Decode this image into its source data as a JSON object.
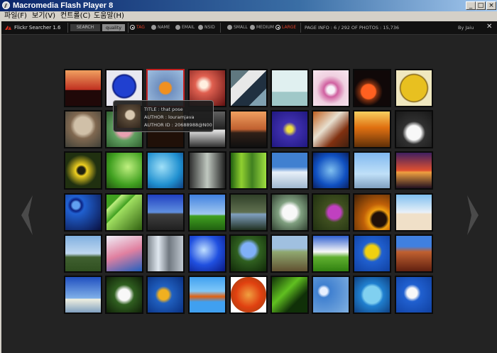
{
  "window": {
    "title": "Macromedia Flash Player 8",
    "minimize": "_",
    "maximize": "□",
    "close": "×"
  },
  "menu": [
    "파일(F)",
    "보기(V)",
    "컨트롤(C)",
    "도움말(H)"
  ],
  "toolbar": {
    "app_title": "Flickr Searcher 1.6",
    "search_label": "SEARCH",
    "query": "quality",
    "filters": [
      {
        "label": "TAG",
        "active": true
      },
      {
        "label": "NAME",
        "active": false
      },
      {
        "label": "EMAIL",
        "active": false
      },
      {
        "label": "NSID",
        "active": false
      }
    ],
    "sizes": [
      {
        "label": "SMALL",
        "active": false
      },
      {
        "label": "MEDIUM",
        "active": false
      },
      {
        "label": "LARGE",
        "active": true
      }
    ],
    "page_info": "PAGE INFO : 6 / 292 OF PHOTOS : 15,736",
    "byline": "By Jaiu",
    "close_glyph": "✕"
  },
  "tooltip": {
    "title_line": "TITLE : that pose",
    "author_line": "AUTHOR : louramjava",
    "author_id_line": "AUTHOR ID : 20688988@N00"
  },
  "grid": {
    "rows": 6,
    "cols": 9,
    "selected_index": 2,
    "tiles": [
      "sunset-tree-silhouette",
      "blue-rose",
      "butterfly-on-flower",
      "pink-bokeh-flower",
      "water-collage",
      "chair-on-beach",
      "pink-lily",
      "orange-slices",
      "gold-seal",
      "squirrel",
      "eye-closeup",
      "sunset-silhouette",
      "dark-seascape",
      "horse-rider-sunset",
      "purple-pansy",
      "bark-texture",
      "golden-field-sunset",
      "white-lilies",
      "yellow-daisy",
      "green-leaf-drops",
      "blue-water-drops",
      "waterfall",
      "green-grass",
      "snow-mountain",
      "blue-water-drop",
      "beach-chair-blue",
      "purple-sunset",
      "blue-cells",
      "green-leaf-veins",
      "road-blue-sky",
      "grass-blue-sky",
      "dark-landscape",
      "dandelion",
      "purple-flower",
      "sunflower-closeup",
      "beach-figure",
      "coast-cliffs",
      "pink-sky-fabric",
      "winter-trees",
      "blue-bubbles",
      "blue-flower-drops",
      "grass-field",
      "green-hills-clouds",
      "yellow-daffodil",
      "red-rock-cliff",
      "ocean-horizon",
      "white-daisy-green",
      "yellow-flower-blue",
      "goldfish",
      "orange-leaves",
      "green-grass-blade",
      "water-droplets",
      "blue-bubble",
      "daisy-blue-sky"
    ]
  },
  "nav": {
    "prev": "previous-page",
    "next": "next-page"
  },
  "colors": {
    "accent_red": "#e04028",
    "background": "#232323",
    "toolbar": "#111111"
  }
}
